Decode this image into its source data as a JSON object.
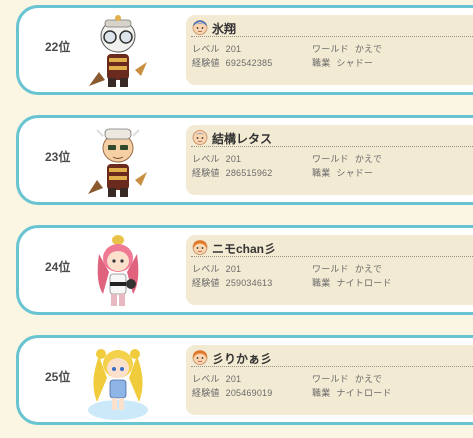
{
  "labels": {
    "level": "レベル",
    "exp": "経験値",
    "world": "ワールド",
    "job": "職業"
  },
  "colors": {
    "background": "#fbf5e3",
    "card_border": "#69c4d2",
    "info_panel": "#f3ead3"
  },
  "rankings": [
    {
      "rank": "22位",
      "name": "氷翔",
      "level": "201",
      "exp": "692542385",
      "world": "かえで",
      "job": "シャドー",
      "face_icon": "male-face-icon"
    },
    {
      "rank": "23位",
      "name": "結構レタス",
      "level": "201",
      "exp": "286515962",
      "world": "かえで",
      "job": "シャドー",
      "face_icon": "male-face-icon"
    },
    {
      "rank": "24位",
      "name": "ニモchan彡",
      "level": "201",
      "exp": "259034613",
      "world": "かえで",
      "job": "ナイトロード",
      "face_icon": "female-face-icon"
    },
    {
      "rank": "25位",
      "name": "彡りかぁ彡",
      "level": "201",
      "exp": "205469019",
      "world": "かえで",
      "job": "ナイトロード",
      "face_icon": "female-face-icon"
    }
  ]
}
